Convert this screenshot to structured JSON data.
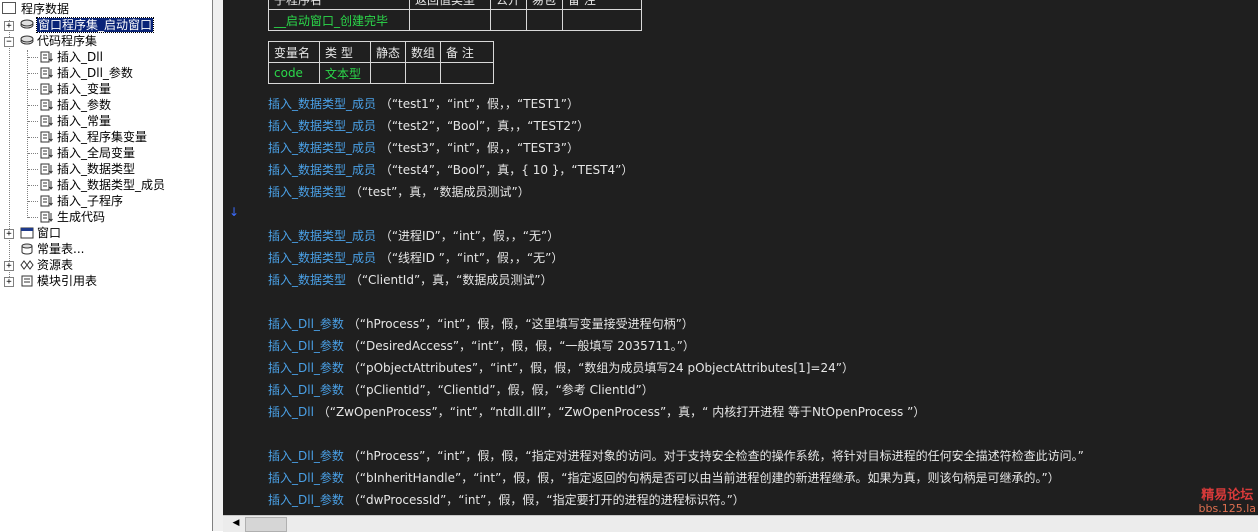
{
  "tree": {
    "root": "程序数据",
    "selected_item": "窗口程序集_启动窗口",
    "assembly": "代码程序集",
    "children": [
      "插入_Dll",
      "插入_Dll_参数",
      "插入_变量",
      "插入_参数",
      "插入_常量",
      "插入_程序集变量",
      "插入_全局变量",
      "插入_数据类型",
      "插入_数据类型_成员",
      "插入_子程序",
      "生成代码"
    ],
    "bottom_items": [
      "窗口",
      "常量表...",
      "资源表",
      "模块引用表"
    ]
  },
  "sub_table": {
    "headers": [
      "子程序名",
      "返回值类型",
      "公开",
      "易包",
      "备 注"
    ],
    "name": "__启动窗口_创建完毕"
  },
  "var_table": {
    "headers": [
      "变量名",
      "类 型",
      "静态",
      "数组",
      "备 注"
    ],
    "row": {
      "name": "code",
      "type": "文本型"
    }
  },
  "code_lines": [
    {
      "fn": "插入_数据类型_成员",
      "args": " （“test1”，“int”，假，，“TEST1”）"
    },
    {
      "fn": "插入_数据类型_成员",
      "args": " （“test2”，“Bool”，真，，“TEST2”）"
    },
    {
      "fn": "插入_数据类型_成员",
      "args": " （“test3”，“int”，假，，“TEST3”）"
    },
    {
      "fn": "插入_数据类型_成员",
      "args": " （“test4”，“Bool”，真，{ 10 }，“TEST4”）"
    },
    {
      "fn": "插入_数据类型",
      "args": " （“test”，真，“数据成员测试”）"
    },
    {
      "fn": "",
      "args": ""
    },
    {
      "fn": "插入_数据类型_成员",
      "args": " （“进程ID”，“int”，假，，“无”）"
    },
    {
      "fn": "插入_数据类型_成员",
      "args": " （“线程ID ”，“int”，假，，“无”）"
    },
    {
      "fn": "插入_数据类型",
      "args": " （“ClientId”，真，“数据成员测试”）"
    },
    {
      "fn": "",
      "args": ""
    },
    {
      "fn": "插入_Dll_参数",
      "args": " （“hProcess”，“int”，假，假，“这里填写变量接受进程句柄”）"
    },
    {
      "fn": "插入_Dll_参数",
      "args": " （“DesiredAccess”，“int”，假，假，“一般填写 2035711。”）"
    },
    {
      "fn": "插入_Dll_参数",
      "args": " （“pObjectAttributes”，“int”，假，假，“数组为成员填写24 pObjectAttributes[1]=24”）"
    },
    {
      "fn": "插入_Dll_参数",
      "args": " （“pClientId”，“ClientId”，假，假，“参考 ClientId”）"
    },
    {
      "fn": "插入_Dll",
      "args": " （“ZwOpenProcess”，“int”，“ntdll.dll”，“ZwOpenProcess”，真，“ 内核打开进程 等于NtOpenProcess ”）"
    },
    {
      "fn": "",
      "args": ""
    },
    {
      "fn": "插入_Dll_参数",
      "args": " （“hProcess”，“int”，假，假，“指定对进程对象的访问。对于支持安全检查的操作系统，将针对目标进程的任何安全描述符检查此访问。”"
    },
    {
      "fn": "插入_Dll_参数",
      "args": " （“bInheritHandle”，“int”，假，假，“指定返回的句柄是否可以由当前进程创建的新进程继承。如果为真，则该句柄是可继承的。”）"
    },
    {
      "fn": "插入_Dll_参数",
      "args": " （“dwProcessId”，“int”，假，假，“指定要打开的进程的进程标识符。”）"
    }
  ],
  "marker": "↓",
  "watermark": {
    "line1": "精易论坛",
    "line2": "bbs.125.la"
  }
}
